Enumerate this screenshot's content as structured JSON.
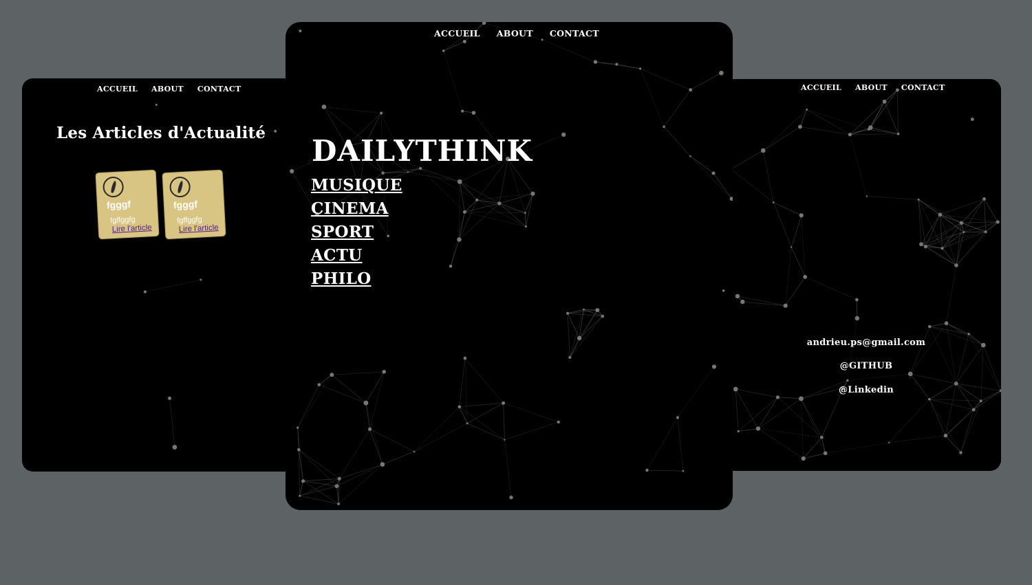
{
  "nav": [
    "ACCUEIL",
    "ABOUT",
    "CONTACT"
  ],
  "left_panel": {
    "title": "Les Articles d'Actualité",
    "cards": [
      {
        "title": "fgggf",
        "description": "fgffggfg",
        "link": "Lire l'article",
        "icon": "quill-logo-icon"
      },
      {
        "title": "fgggf",
        "description": "fgffggfg",
        "link": "Lire l'article",
        "icon": "quill-logo-icon"
      }
    ]
  },
  "center_panel": {
    "title": "DAILYTHINK",
    "menu": [
      "MUSIQUE",
      "CINEMA",
      "SPORT",
      "ACTU",
      "PHILO"
    ]
  },
  "right_panel": {
    "email": "andrieu.ps@gmail.com",
    "github": "@GITHUB",
    "linkedin": "@Linkedin"
  },
  "colors": {
    "page_background": "#5d6264",
    "panel_background": "#000000",
    "card_background": "#d9c583",
    "link_visited": "#551a8b"
  }
}
